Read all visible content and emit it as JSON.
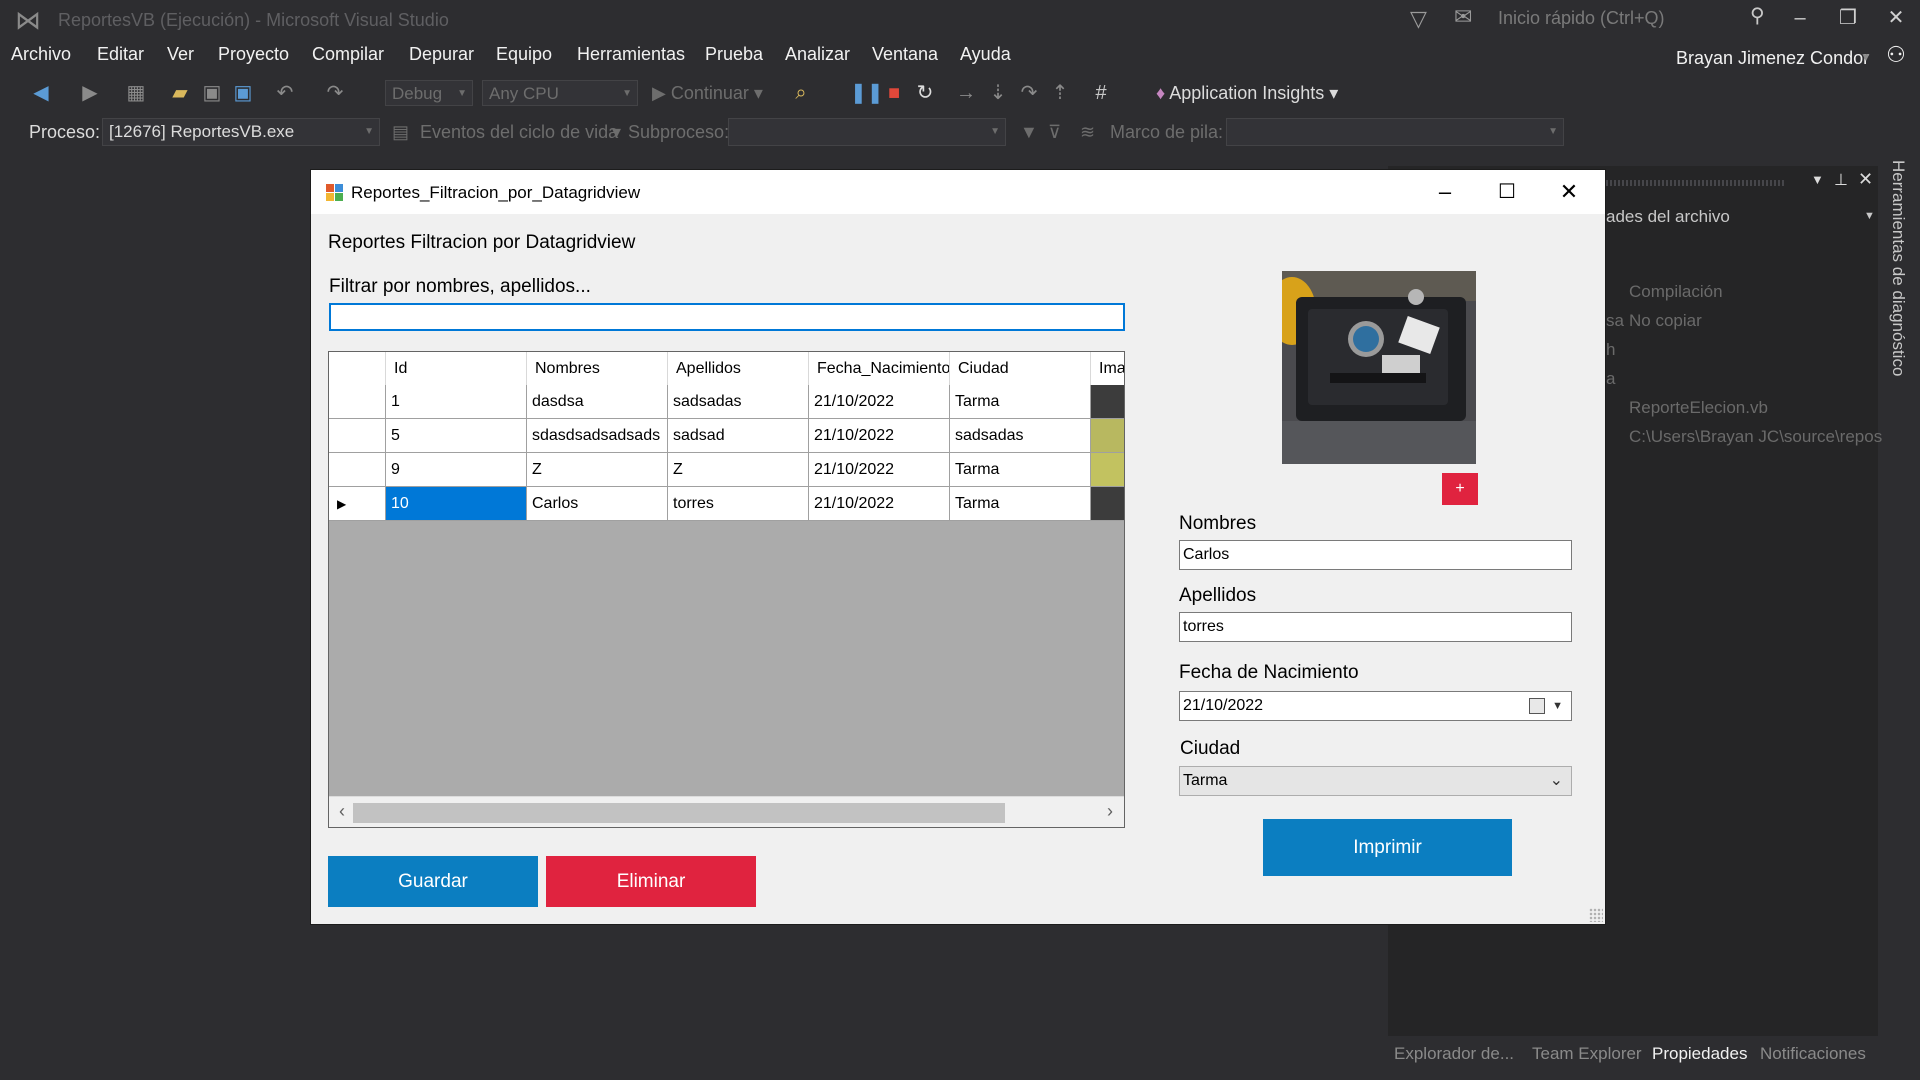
{
  "vs": {
    "title": "ReportesVB (Ejecución) - Microsoft Visual Studio",
    "quick_launch_placeholder": "Inicio rápido (Ctrl+Q)",
    "user": "Brayan Jimenez Condor",
    "menu": [
      "Archivo",
      "Editar",
      "Ver",
      "Proyecto",
      "Compilar",
      "Depurar",
      "Equipo",
      "Herramientas",
      "Prueba",
      "Analizar",
      "Ventana",
      "Ayuda"
    ],
    "toolbar": {
      "config": "Debug",
      "platform": "Any CPU",
      "continue_label": "Continuar",
      "app_insights": "Application Insights"
    },
    "debug_location": {
      "process_label": "Proceso:",
      "process_value": "[12676] ReportesVB.exe",
      "lifecycle_label": "Eventos del ciclo de vida",
      "thread_label": "Subproceso:",
      "stack_label": "Marco de pila:"
    },
    "properties_panel": {
      "title_fragment": "ades del archivo",
      "row_build": "Compilación",
      "row_copy_prefix": "sa",
      "row_copy": "No copiar",
      "row_h": "h",
      "row_a": "a",
      "file_name": "ReporteElecion.vb",
      "file_path": "C:\\Users\\Brayan JC\\source\\repos"
    },
    "diagnostics_tab": "Herramientas de diagnóstico",
    "bottom_tabs": [
      "Explorador de...",
      "Team Explorer",
      "Propiedades",
      "Notificaciones"
    ],
    "active_bottom_tab": "Propiedades"
  },
  "form": {
    "title": "Reportes_Filtracion_por_Datagridview",
    "heading": "Reportes Filtracion por Datagridview",
    "filter_label": "Filtrar por nombres, apellidos...",
    "filter_value": "",
    "grid": {
      "columns": [
        "Id",
        "Nombres",
        "Apellidos",
        "Fecha_Nacimiento",
        "Ciudad",
        "Ima"
      ],
      "rows": [
        {
          "id": "1",
          "nombres": "dasdsa",
          "apellidos": "sadsadas",
          "fecha": "21/10/2022",
          "ciudad": "Tarma",
          "img_color": "#3c3c3c"
        },
        {
          "id": "5",
          "nombres": "sdasdsadsadsads",
          "apellidos": "sadsad",
          "fecha": "21/10/2022",
          "ciudad": "sadsadas",
          "img_color": "#b8b860"
        },
        {
          "id": "9",
          "nombres": "Z",
          "apellidos": "Z",
          "fecha": "21/10/2022",
          "ciudad": "Tarma",
          "img_color": "#c2c260"
        },
        {
          "id": "10",
          "nombres": "Carlos",
          "apellidos": "torres",
          "fecha": "21/10/2022",
          "ciudad": "Tarma",
          "img_color": "#3c3c3c"
        }
      ],
      "current_row_marker": "▶"
    },
    "buttons": {
      "guardar": "Guardar",
      "eliminar": "Eliminar",
      "imprimir": "Imprimir",
      "add_photo": "+"
    },
    "fields": {
      "nombres_label": "Nombres",
      "nombres_value": "Carlos",
      "apellidos_label": "Apellidos",
      "apellidos_value": "torres",
      "fecha_label": "Fecha de Nacimiento",
      "fecha_value": "21/10/2022",
      "ciudad_label": "Ciudad",
      "ciudad_value": "Tarma"
    }
  }
}
